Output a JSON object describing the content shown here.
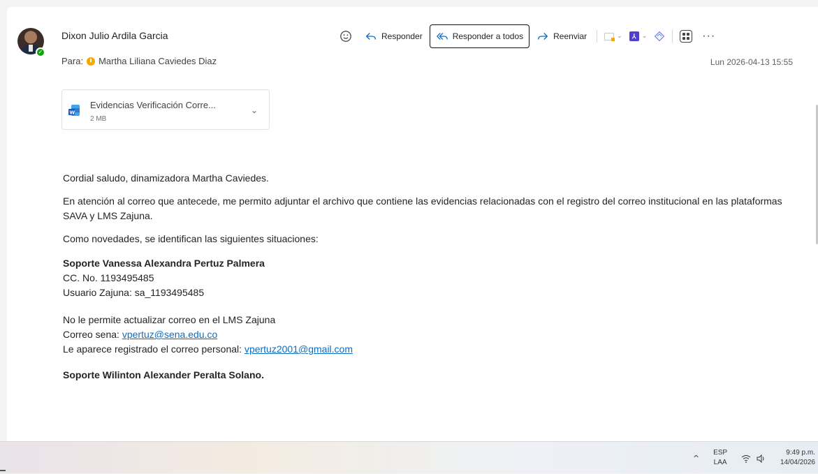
{
  "message": {
    "sender_name": "Dixon Julio Ardila Garcia",
    "to_label": "Para:",
    "to_name": "Martha Liliana Caviedes Diaz",
    "date": "Lun 2026-04-13 15:55"
  },
  "toolbar": {
    "reply_label": "Responder",
    "reply_all_label": "Responder a todos",
    "forward_label": "Reenviar"
  },
  "attachment": {
    "name": "Evidencias Verificación Corre...",
    "size": "2 MB"
  },
  "body": {
    "greeting": "Cordial saludo, dinamizadora Martha Caviedes.",
    "intro": "En atención al correo que antecede, me permito adjuntar el archivo que contiene las evidencias relacionadas con el registro del correo institucional en las plataformas SAVA y LMS Zajuna.",
    "novedades": "Como novedades, se identifican las siguientes situaciones:",
    "case1_title": "Soporte Vanessa Alexandra Pertuz Palmera",
    "case1_cc": "CC. No. 1193495485",
    "case1_user": "Usuario Zajuna: sa_1193495485",
    "case1_issue": "No le permite actualizar correo en el LMS Zajuna",
    "case1_sena_label": "Correo sena: ",
    "case1_sena_email": "vpertuz@sena.edu.co",
    "case1_personal_label": "Le aparece registrado el correo personal: ",
    "case1_personal_email": "vpertuz2001@gmail.com",
    "case2_title": "Soporte Wilinton Alexander Peralta Solano."
  },
  "taskbar": {
    "lang_top": "ESP",
    "lang_bottom": "LAA",
    "time": "9:49 p.m.",
    "date": "14/04/2026"
  },
  "colors": {
    "accent": "#0f6cbd",
    "presence": "#13a10e",
    "contact_dot": "#f7a800"
  }
}
